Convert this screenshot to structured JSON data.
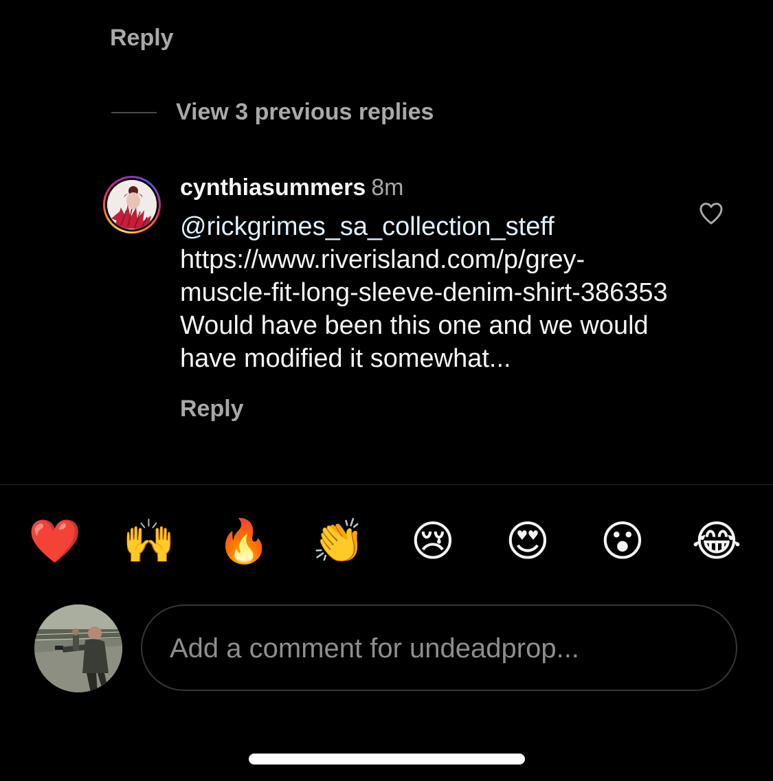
{
  "top_reply": {
    "label": "Reply"
  },
  "view_replies": {
    "label": "View 3 previous replies"
  },
  "comment": {
    "username": "cynthiasummers",
    "time": "8m",
    "mention": "@rickgrimes_sa_collection_steff",
    "text": " https://www.riverisland.com/p/grey-muscle-fit-long-sleeve-denim-shirt-386353  Would have been this one and we would have modified it somewhat...",
    "reply_label": "Reply",
    "like_icon": "heart-outline-icon"
  },
  "quick_reactions": [
    {
      "name": "red-heart-emoji",
      "glyph": "❤️"
    },
    {
      "name": "raising-hands-emoji",
      "glyph": "🙌"
    },
    {
      "name": "fire-emoji",
      "glyph": "🔥"
    },
    {
      "name": "clapping-hands-emoji",
      "glyph": "👏"
    },
    {
      "name": "crying-face-emoji",
      "glyph": "😢"
    },
    {
      "name": "heart-eyes-emoji",
      "glyph": "😍"
    },
    {
      "name": "surprised-face-emoji",
      "glyph": "😮"
    },
    {
      "name": "tears-of-joy-emoji",
      "glyph": "😂"
    }
  ],
  "composer": {
    "placeholder": "Add a comment for undeadprop..."
  },
  "colors": {
    "background": "#000000",
    "muted_text": "#a8a8a8",
    "mention": "#e0f1ff",
    "divider": "#262626"
  }
}
